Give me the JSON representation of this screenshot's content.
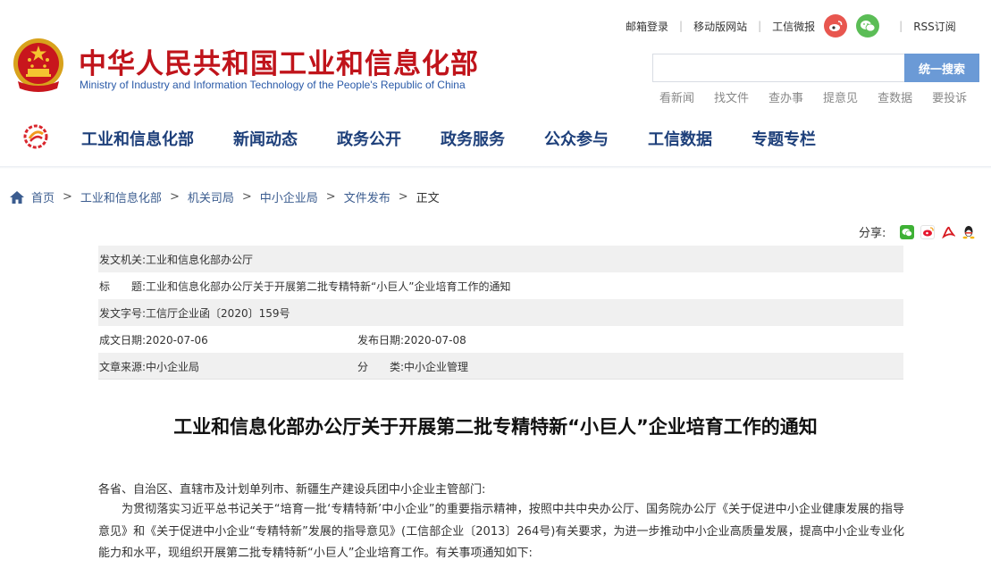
{
  "header": {
    "site_title": "中华人民共和国工业和信息化部",
    "site_subtitle": "Ministry of Industry and Information Technology of the People's Republic of China",
    "toplinks": {
      "mail_login": "邮箱登录",
      "mobile_site": "移动版网站",
      "weibo": "工信微报",
      "rss": "RSS订阅"
    },
    "search": {
      "placeholder": "",
      "button": "统一搜索"
    },
    "quicklinks": [
      "看新闻",
      "找文件",
      "查办事",
      "提意见",
      "查数据",
      "要投诉"
    ],
    "nav": [
      "工业和信息化部",
      "新闻动态",
      "政务公开",
      "政务服务",
      "公众参与",
      "工信数据",
      "专题专栏"
    ]
  },
  "breadcrumb": {
    "items": [
      "首页",
      "工业和信息化部",
      "机关司局",
      "中小企业局",
      "文件发布"
    ],
    "current": "正文"
  },
  "share": {
    "label": "分享:"
  },
  "meta": {
    "issuer_label": "发文机关:",
    "issuer": "工业和信息化部办公厅",
    "title_label": "标　　题:",
    "title": "工业和信息化部办公厅关于开展第二批专精特新“小巨人”企业培育工作的通知",
    "doc_no_label": "发文字号:",
    "doc_no": "工信厅企业函〔2020〕159号",
    "created_label": "成文日期:",
    "created": "2020-07-06",
    "published_label": "发布日期:",
    "published": "2020-07-08",
    "source_label": "文章来源:",
    "source": "中小企业局",
    "category_label": "分　　类:",
    "category": "中小企业管理"
  },
  "article": {
    "title": "工业和信息化部办公厅关于开展第二批专精特新“小巨人”企业培育工作的通知",
    "salutation": "各省、自治区、直辖市及计划单列市、新疆生产建设兵团中小企业主管部门:",
    "paragraph": "为贯彻落实习近平总书记关于“培育一批‘专精特新’中小企业”的重要指示精神，按照中共中央办公厅、国务院办公厅《关于促进中小企业健康发展的指导意见》和《关于促进中小企业“专精特新”发展的指导意见》(工信部企业〔2013〕264号)有关要求，为进一步推动中小企业高质量发展，提高中小企业专业化能力和水平，现组织开展第二批专精特新“小巨人”企业培育工作。有关事项通知如下:"
  },
  "colors": {
    "title_red": "#c0141b",
    "nav_blue": "#1d3f7a",
    "search_button": "#6b9ad6",
    "weibo_red": "#e8564f",
    "wechat_green": "#5bbd56"
  }
}
